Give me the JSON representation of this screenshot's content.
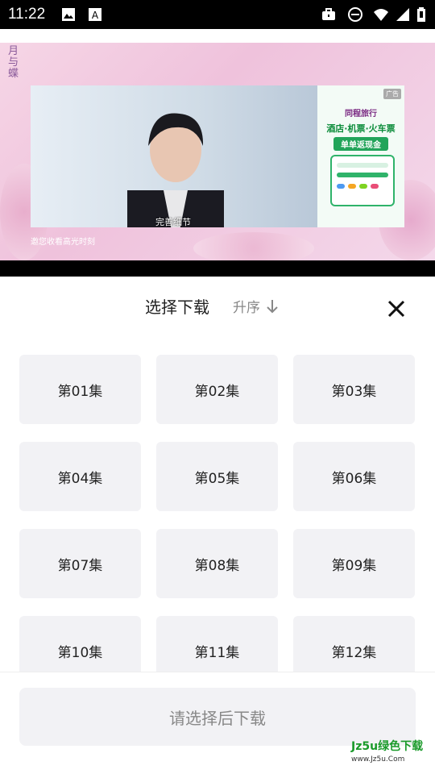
{
  "status_bar": {
    "time": "11:22",
    "icons": [
      "image-icon",
      "text-icon",
      "briefcase-icon",
      "dnd-icon",
      "wifi-icon",
      "signal-icon",
      "battery-icon"
    ]
  },
  "video": {
    "subtitle": "完善细节",
    "watch_text": "邀您收看高光时刻",
    "ad": {
      "tag": "广告",
      "brand": "同程旅行",
      "line1": "酒店·机票·火车票",
      "line2": "单单返现金"
    }
  },
  "sheet": {
    "title": "选择下载",
    "sort_label": "升序",
    "episodes": [
      "第01集",
      "第02集",
      "第03集",
      "第04集",
      "第05集",
      "第06集",
      "第07集",
      "第08集",
      "第09集",
      "第10集",
      "第11集",
      "第12集"
    ],
    "download_button": "请选择后下载"
  },
  "watermark": {
    "main": "Jz5u绿色下载",
    "sub": "www.Jz5u.Com"
  },
  "colors": {
    "tile_bg": "#f2f2f5",
    "accent_green": "#1a9a2a"
  }
}
